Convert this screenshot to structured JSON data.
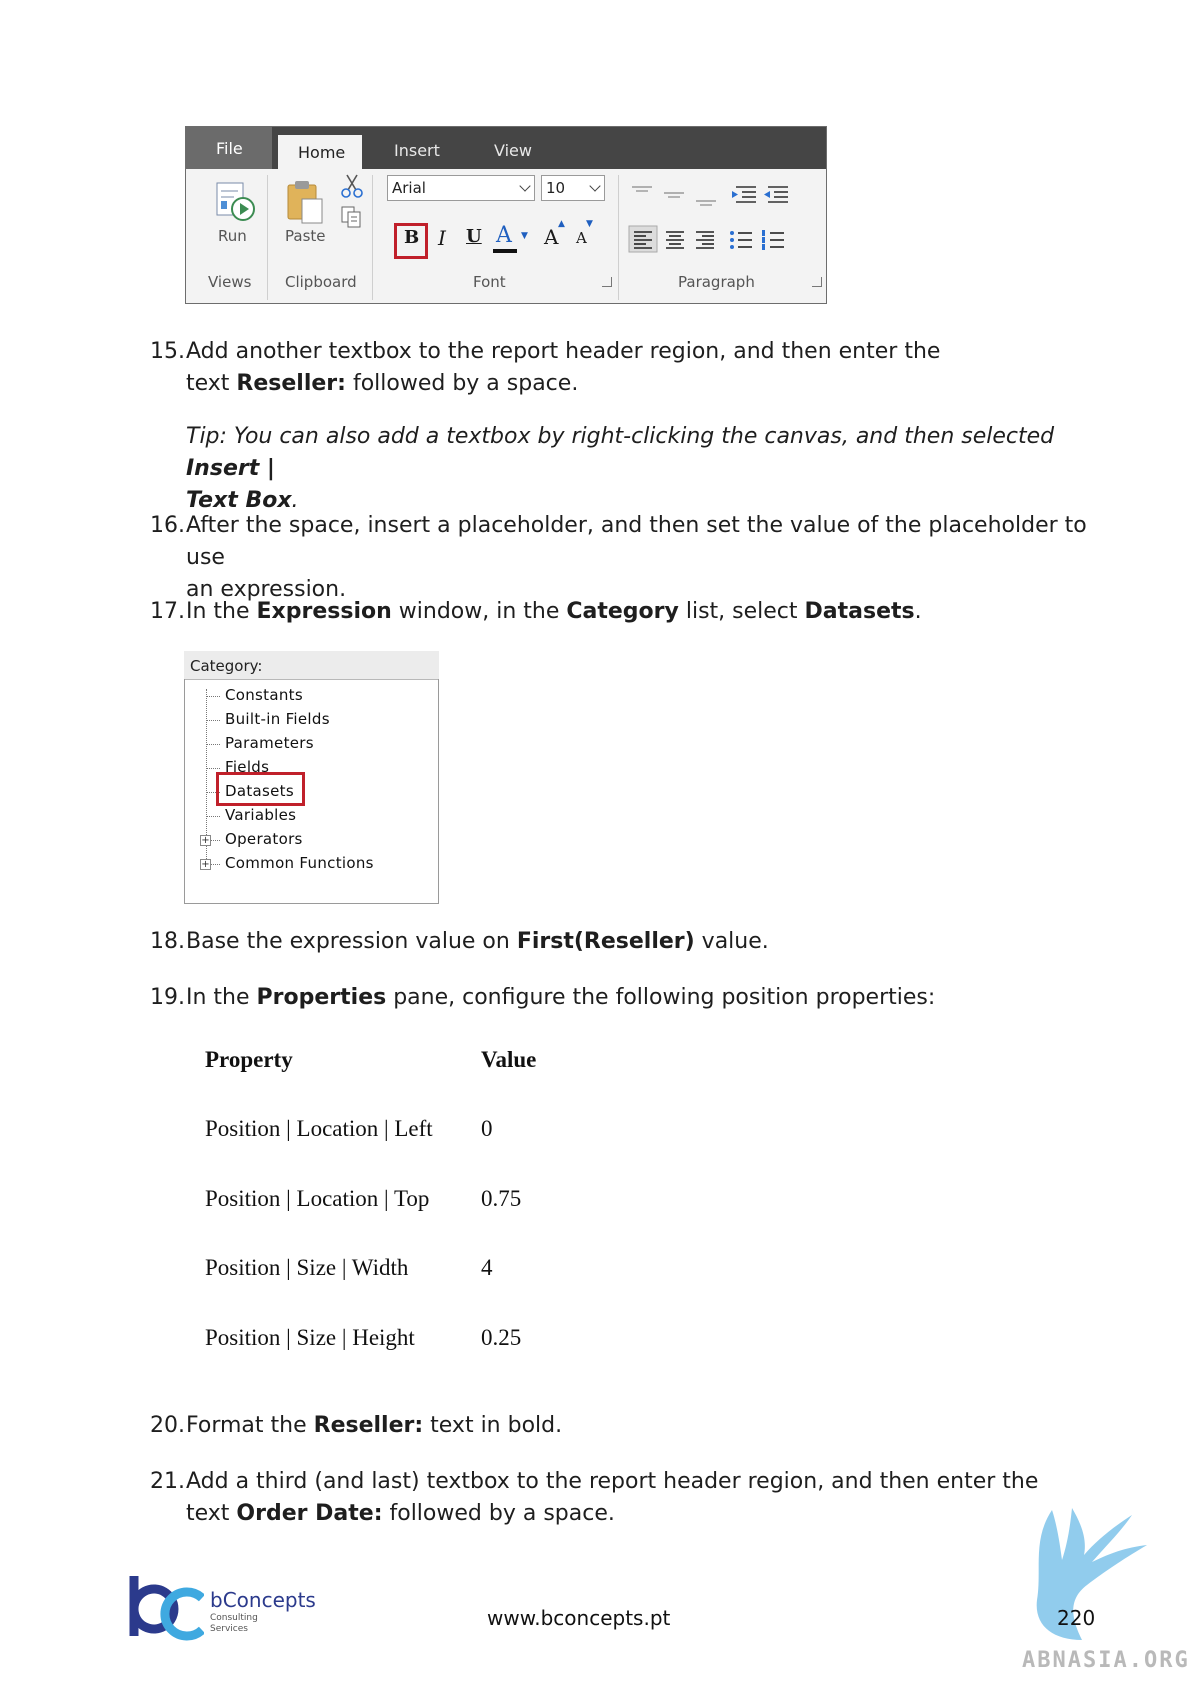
{
  "ribbon": {
    "tabs": [
      "File",
      "Home",
      "Insert",
      "View"
    ],
    "groups": {
      "views": {
        "button": "Run",
        "label": "Views"
      },
      "clipboard": {
        "button": "Paste",
        "label": "Clipboard"
      },
      "font": {
        "family": "Arial",
        "size": "10",
        "label": "Font",
        "bold": "B",
        "italic": "I",
        "underline": "U",
        "color": "A",
        "grow": "A",
        "shrink": "A"
      },
      "paragraph": {
        "label": "Paragraph"
      }
    },
    "highlight_color": "#c0202a"
  },
  "steps": [
    {
      "num": "15.",
      "line1": "Add another textbox to the report header region, and then enter the",
      "line2_pre": "text ",
      "line2_bold": "Reseller:",
      "line2_post": " followed by a space."
    },
    {
      "tip_pre": "Tip: You can also add a textbox by right-clicking the canvas, and then selected ",
      "tip_bold1": "Insert |",
      "tip_bold2": "Text Box",
      "tip_post": "."
    },
    {
      "num": "16.",
      "line1": "After the space, insert a placeholder, and then set the value of the placeholder to use",
      "line2": "an expression."
    },
    {
      "num": "17.",
      "t1": "In the ",
      "b1": "Expression",
      "t2": " window, in the ",
      "b2": "Category",
      "t3": " list, select ",
      "b3": "Datasets",
      "t4": "."
    },
    {
      "num": "18.",
      "t1": "Base the expression value on ",
      "b1": "First(Reseller)",
      "t2": " value."
    },
    {
      "num": "19.",
      "t1": "In the ",
      "b1": "Properties",
      "t2": " pane, configure the following position properties:"
    },
    {
      "num": "20.",
      "t1": "Format the ",
      "b1": "Reseller:",
      "t2": " text in bold."
    },
    {
      "num": "21.",
      "line1": "Add a third (and last) textbox to the report header region, and then enter the",
      "line2_pre": "text ",
      "line2_bold": "Order Date:",
      "line2_post": " followed by a space."
    }
  ],
  "category": {
    "header": "Category:",
    "items": [
      "Constants",
      "Built-in Fields",
      "Parameters",
      "Fields",
      "Datasets",
      "Variables",
      "Operators",
      "Common Functions"
    ]
  },
  "table": {
    "headers": [
      "Property",
      "Value"
    ],
    "rows": [
      [
        "Position | Location | Left",
        "0"
      ],
      [
        "Position | Location | Top",
        "0.75"
      ],
      [
        "Position | Size | Width",
        "4"
      ],
      [
        "Position | Size | Height",
        "0.25"
      ]
    ]
  },
  "footer": {
    "logo_name": "bConcepts",
    "logo_sub1": "Consulting",
    "logo_sub2": "Services",
    "url": "www.bconcepts.pt",
    "page": "220",
    "watermark": "ABNASIA.ORG"
  },
  "colors": {
    "brand_blue": "#2b3a8c",
    "logo_light_blue": "#3fa9e0",
    "mascot_blue": "#7ec3ea"
  }
}
